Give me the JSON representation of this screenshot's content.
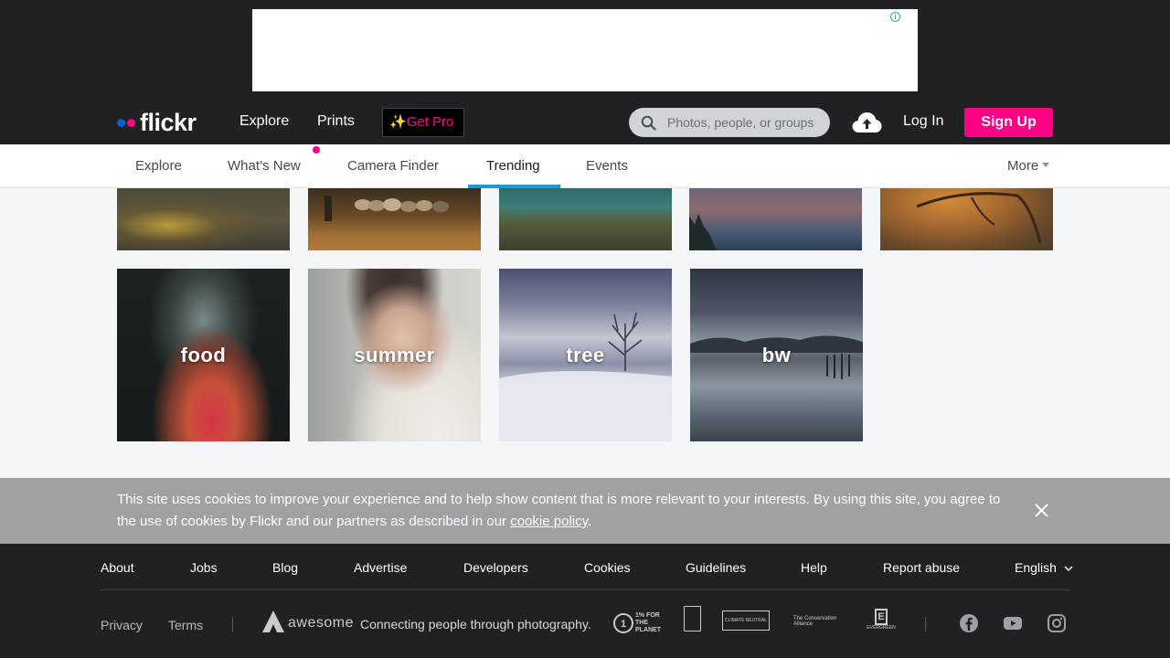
{
  "ad": {
    "info_icon": "info-icon"
  },
  "header": {
    "brand": "flickr",
    "nav": [
      "Explore",
      "Prints"
    ],
    "get_pro": "Get Pro",
    "search_placeholder": "Photos, people, or groups",
    "login": "Log In",
    "signup": "Sign Up",
    "colors": {
      "brand_blue": "#0063dc",
      "brand_pink": "#ff0084",
      "header_bg": "#212124"
    }
  },
  "subnav": {
    "items": [
      "Explore",
      "What’s New",
      "Camera Finder",
      "Trending",
      "Events"
    ],
    "active": "Trending",
    "more": "More"
  },
  "tiles": {
    "top_row": [
      "forest-leaves",
      "sheep-field",
      "lake-cliffs",
      "dusk-lake",
      "autumn-branches"
    ],
    "bottom_row": [
      {
        "label": "food"
      },
      {
        "label": "summer"
      },
      {
        "label": "tree"
      },
      {
        "label": "bw"
      }
    ]
  },
  "cookie": {
    "text_before": "This site uses cookies to improve your experience and to help show content that is more relevant to your interests. By using this site, you agree to the use of cookies by Flickr and our partners as described in our ",
    "link": "cookie policy",
    "text_after": "."
  },
  "footer": {
    "links": [
      "About",
      "Jobs",
      "Blog",
      "Advertise",
      "Developers",
      "Cookies",
      "Guidelines",
      "Help",
      "Report abuse"
    ],
    "language": "English",
    "secondary": [
      "Privacy",
      "Terms"
    ],
    "smugmug_word": "awesome",
    "tagline": "Connecting people through photography.",
    "badges": [
      "1% FOR THE PLANET",
      "CLIMATE NEUTRAL",
      "The Conservation Alliance",
      "EVERGREEN"
    ],
    "social": [
      "facebook-icon",
      "youtube-icon",
      "instagram-icon"
    ]
  }
}
